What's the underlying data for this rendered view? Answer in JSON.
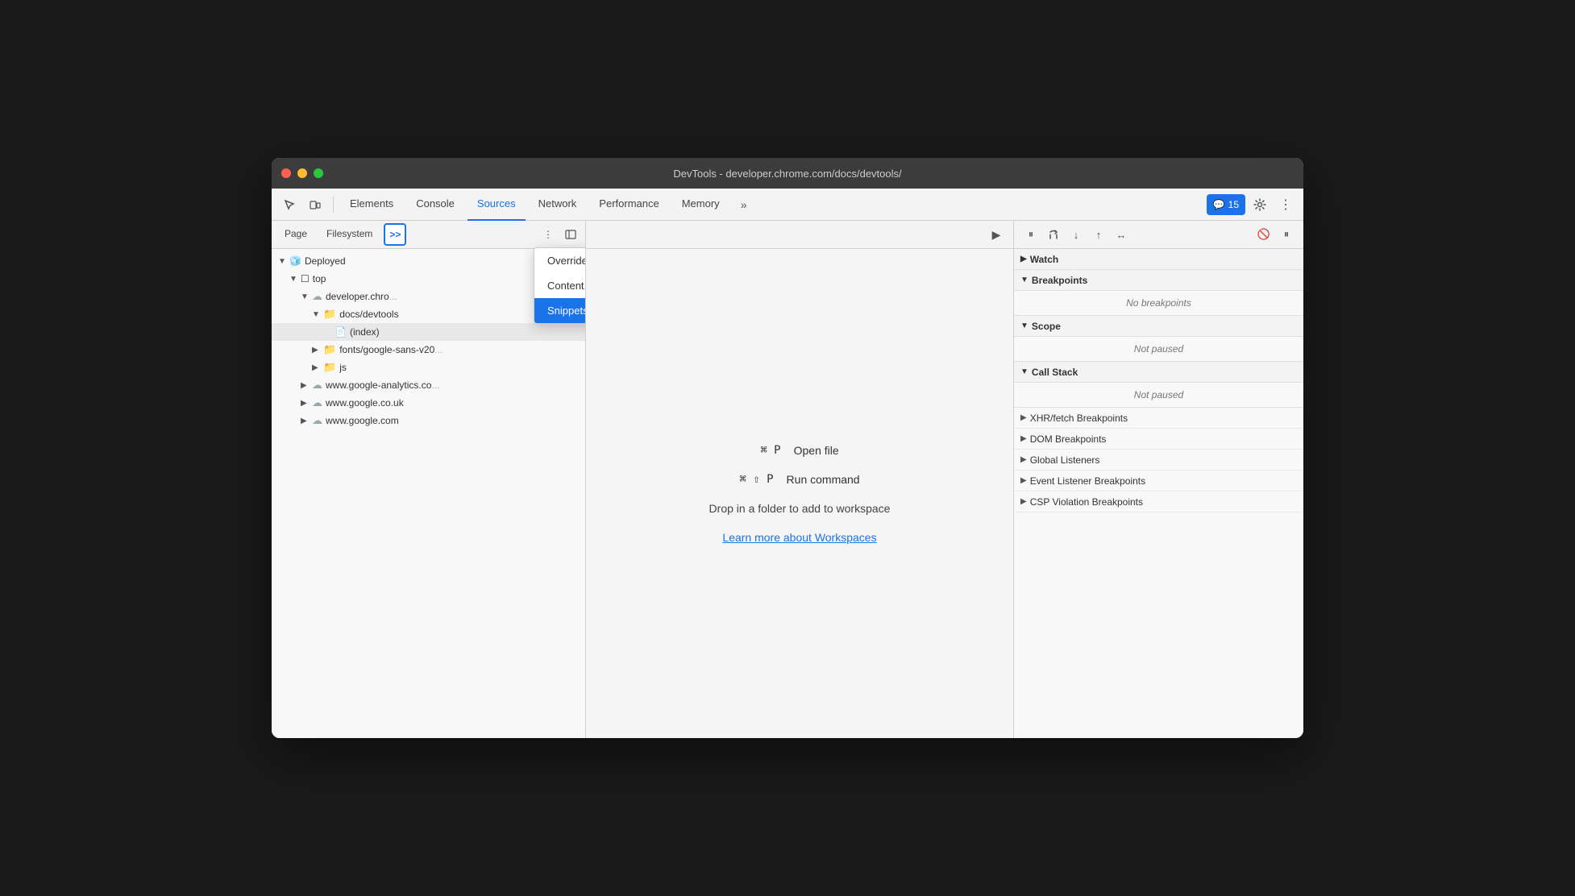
{
  "window": {
    "title": "DevTools - developer.chrome.com/docs/devtools/"
  },
  "topTabs": [
    {
      "id": "elements",
      "label": "Elements",
      "active": false
    },
    {
      "id": "console",
      "label": "Console",
      "active": false
    },
    {
      "id": "sources",
      "label": "Sources",
      "active": true
    },
    {
      "id": "network",
      "label": "Network",
      "active": false
    },
    {
      "id": "performance",
      "label": "Performance",
      "active": false
    },
    {
      "id": "memory",
      "label": "Memory",
      "active": false
    }
  ],
  "notification": {
    "icon": "💬",
    "count": "15"
  },
  "sourceTabs": [
    {
      "id": "page",
      "label": "Page"
    },
    {
      "id": "filesystem",
      "label": "Filesystem"
    }
  ],
  "moreButton": {
    "label": ">>"
  },
  "dropdownMenu": {
    "items": [
      {
        "id": "overrides",
        "label": "Overrides",
        "active": false
      },
      {
        "id": "content-scripts",
        "label": "Content scripts",
        "active": false
      },
      {
        "id": "snippets",
        "label": "Snippets",
        "active": true
      }
    ]
  },
  "fileTree": [
    {
      "id": "deployed",
      "label": "Deployed",
      "indent": 0,
      "type": "cube",
      "arrow": "▼"
    },
    {
      "id": "top",
      "label": "top",
      "indent": 1,
      "type": "square",
      "arrow": "▼"
    },
    {
      "id": "developer-chrome",
      "label": "developer.chrome.com",
      "indent": 2,
      "type": "cloud",
      "arrow": "▼",
      "truncated": true
    },
    {
      "id": "docs-devtools",
      "label": "docs/devtools",
      "indent": 3,
      "type": "folder",
      "arrow": "▼"
    },
    {
      "id": "index",
      "label": "(index)",
      "indent": 4,
      "type": "file",
      "arrow": "",
      "selected": true
    },
    {
      "id": "fonts-google",
      "label": "fonts/google-sans-v20...",
      "indent": 3,
      "type": "folder",
      "arrow": "▶"
    },
    {
      "id": "js",
      "label": "js",
      "indent": 3,
      "type": "folder",
      "arrow": "▶"
    },
    {
      "id": "www-google-analytics",
      "label": "www.google-analytics.co...",
      "indent": 2,
      "type": "cloud",
      "arrow": "▶"
    },
    {
      "id": "www-google-co-uk",
      "label": "www.google.co.uk",
      "indent": 2,
      "type": "cloud",
      "arrow": "▶"
    },
    {
      "id": "www-google-com",
      "label": "www.google.com",
      "indent": 2,
      "type": "cloud",
      "arrow": "▶"
    }
  ],
  "centerContent": {
    "shortcut1": {
      "key": "⌘ P",
      "label": "Open file"
    },
    "shortcut2": {
      "key": "⌘ ⇧ P",
      "label": "Run command"
    },
    "dropText": "Drop in a folder to add to workspace",
    "workspaceLink": "Learn more about Workspaces"
  },
  "rightPanel": {
    "sections": [
      {
        "id": "watch",
        "label": "Watch",
        "collapsed": true,
        "arrow": "▶",
        "content": null
      },
      {
        "id": "breakpoints",
        "label": "Breakpoints",
        "collapsed": false,
        "arrow": "▼",
        "content": "No breakpoints"
      },
      {
        "id": "scope",
        "label": "Scope",
        "collapsed": false,
        "arrow": "▼",
        "content": "Not paused"
      },
      {
        "id": "call-stack",
        "label": "Call Stack",
        "collapsed": false,
        "arrow": "▼",
        "content": "Not paused"
      },
      {
        "id": "xhr-fetch",
        "label": "XHR/fetch Breakpoints",
        "collapsed": true,
        "arrow": "▶",
        "content": null
      },
      {
        "id": "dom-breakpoints",
        "label": "DOM Breakpoints",
        "collapsed": true,
        "arrow": "▶",
        "content": null
      },
      {
        "id": "global-listeners",
        "label": "Global Listeners",
        "collapsed": true,
        "arrow": "▶",
        "content": null
      },
      {
        "id": "event-listener",
        "label": "Event Listener Breakpoints",
        "collapsed": true,
        "arrow": "▶",
        "content": null
      },
      {
        "id": "csp-violation",
        "label": "CSP Violation Breakpoints",
        "collapsed": true,
        "arrow": "▶",
        "content": null
      }
    ]
  }
}
